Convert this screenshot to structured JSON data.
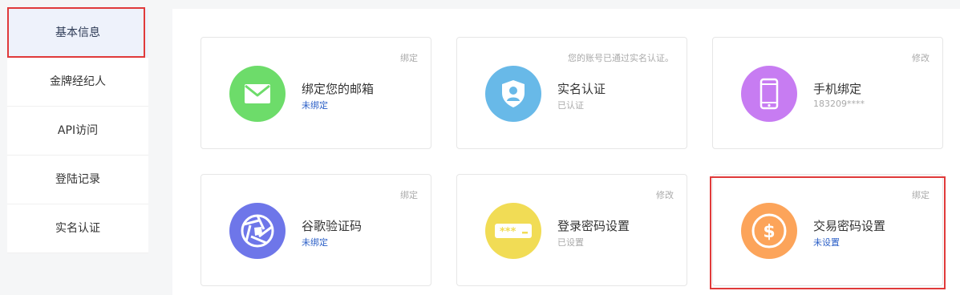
{
  "sidebar": {
    "items": [
      {
        "label": "基本信息"
      },
      {
        "label": "金牌经纪人"
      },
      {
        "label": "API访问"
      },
      {
        "label": "登陆记录"
      },
      {
        "label": "实名认证"
      }
    ]
  },
  "cards": [
    {
      "title": "绑定您的邮箱",
      "status": "未绑定",
      "action": "绑定",
      "icon": "envelope-icon",
      "color": "#6ddc6a"
    },
    {
      "title": "实名认证",
      "status": "已认证",
      "action": "您的账号已通过实名认证。",
      "icon": "shield-user-icon",
      "color": "#68b9e8"
    },
    {
      "title": "手机绑定",
      "status": "183209****",
      "action": "修改",
      "icon": "mobile-phone-icon",
      "color": "#c77cf2"
    },
    {
      "title": "谷歌验证码",
      "status": "未绑定",
      "action": "绑定",
      "icon": "aperture-icon",
      "color": "#6e76e9"
    },
    {
      "title": "登录密码设置",
      "status": "已设置",
      "action": "修改",
      "icon": "password-icon",
      "color": "#f1dc55"
    },
    {
      "title": "交易密码设置",
      "status": "未设置",
      "action": "绑定",
      "icon": "dollar-coin-icon",
      "color": "#fca45a"
    }
  ],
  "colors": {
    "highlight_border": "#e03a3a",
    "active_bg": "#eef2fb",
    "link_blue": "#2b5fc7"
  }
}
